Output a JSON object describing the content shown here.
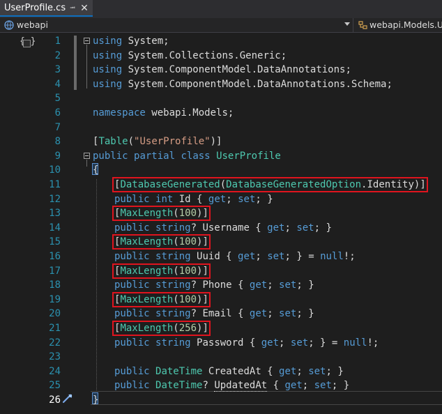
{
  "tab": {
    "filename": "UserProfile.cs",
    "pin_icon": "pin-icon",
    "close_icon": "close-icon"
  },
  "navbar": {
    "project": "webapi",
    "type": "webapi.Models.UserProfile"
  },
  "editor": {
    "current_line": 26,
    "lines": [
      {
        "n": "1",
        "text": "using System;"
      },
      {
        "n": "2",
        "text": "using System.Collections.Generic;"
      },
      {
        "n": "3",
        "text": "using System.ComponentModel.DataAnnotations;"
      },
      {
        "n": "4",
        "text": "using System.ComponentModel.DataAnnotations.Schema;"
      },
      {
        "n": "5",
        "text": ""
      },
      {
        "n": "6",
        "text": "namespace webapi.Models;"
      },
      {
        "n": "7",
        "text": ""
      },
      {
        "n": "8",
        "text": "[Table(\"UserProfile\")]"
      },
      {
        "n": "9",
        "text": "public partial class UserProfile"
      },
      {
        "n": "10",
        "text": "{"
      },
      {
        "n": "11",
        "text": "[DatabaseGenerated(DatabaseGeneratedOption.Identity)]"
      },
      {
        "n": "12",
        "text": "public int Id { get; set; }"
      },
      {
        "n": "13",
        "text": "[MaxLength(100)]"
      },
      {
        "n": "14",
        "text": "public string? Username { get; set; }"
      },
      {
        "n": "15",
        "text": "[MaxLength(100)]"
      },
      {
        "n": "16",
        "text": "public string Uuid { get; set; } = null!;"
      },
      {
        "n": "17",
        "text": "[MaxLength(100)]"
      },
      {
        "n": "18",
        "text": "public string? Phone { get; set; }"
      },
      {
        "n": "19",
        "text": "[MaxLength(100)]"
      },
      {
        "n": "20",
        "text": "public string? Email { get; set; }"
      },
      {
        "n": "21",
        "text": "[MaxLength(256)]"
      },
      {
        "n": "22",
        "text": "public string Password { get; set; } = null!;"
      },
      {
        "n": "23",
        "text": ""
      },
      {
        "n": "24",
        "text": "public DateTime CreatedAt { get; set; }"
      },
      {
        "n": "25",
        "text": "public DateTime? UpdatedAt { get; set; }"
      },
      {
        "n": "26",
        "text": "}"
      }
    ],
    "highlighted_lines": [
      11,
      13,
      15,
      17,
      19,
      21
    ],
    "highlight_color": "#e0141e"
  },
  "colors": {
    "keyword": "#569cd6",
    "type": "#4ec9b0",
    "string": "#d69d85",
    "number": "#b5cea8",
    "line_number": "#2b91af",
    "background": "#1e1e1e"
  }
}
